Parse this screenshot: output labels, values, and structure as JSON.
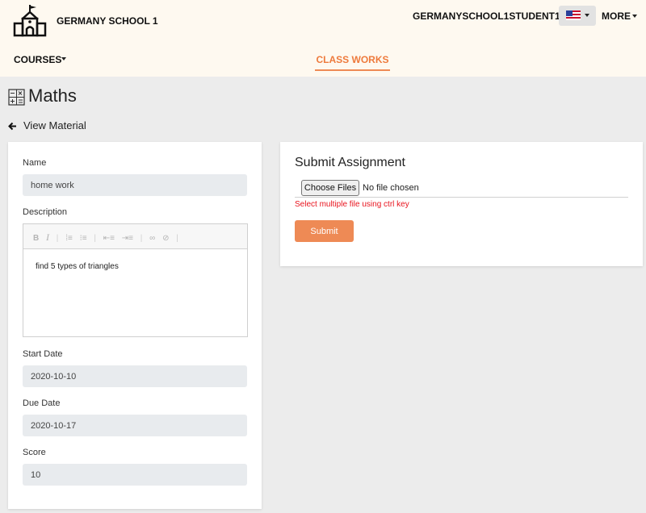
{
  "header": {
    "school_name": "GERMANY SCHOOL 1",
    "username": "GERMANYSCHOOL1STUDENT1",
    "language_flag": "us-flag-icon",
    "more_label": "MORE"
  },
  "nav": {
    "courses_label": "COURSES",
    "class_works_label": "CLASS WORKS"
  },
  "page": {
    "title": "Maths",
    "back_label": "View Material"
  },
  "material": {
    "name_label": "Name",
    "name_value": "home work",
    "description_label": "Description",
    "description_text": "find 5 types of triangles",
    "start_date_label": "Start Date",
    "start_date_value": "2020-10-10",
    "due_date_label": "Due Date",
    "due_date_value": "2020-10-17",
    "score_label": "Score",
    "score_value": "10"
  },
  "submit": {
    "title": "Submit Assignment",
    "choose_files_label": "Choose Files",
    "file_status": "No file chosen",
    "hint": "Select multiple file using ctrl key",
    "submit_label": "Submit"
  },
  "colors": {
    "accent": "#ee8a55",
    "header_bg": "#fef9f0",
    "page_bg": "#ececec",
    "error": "#e8141e"
  }
}
